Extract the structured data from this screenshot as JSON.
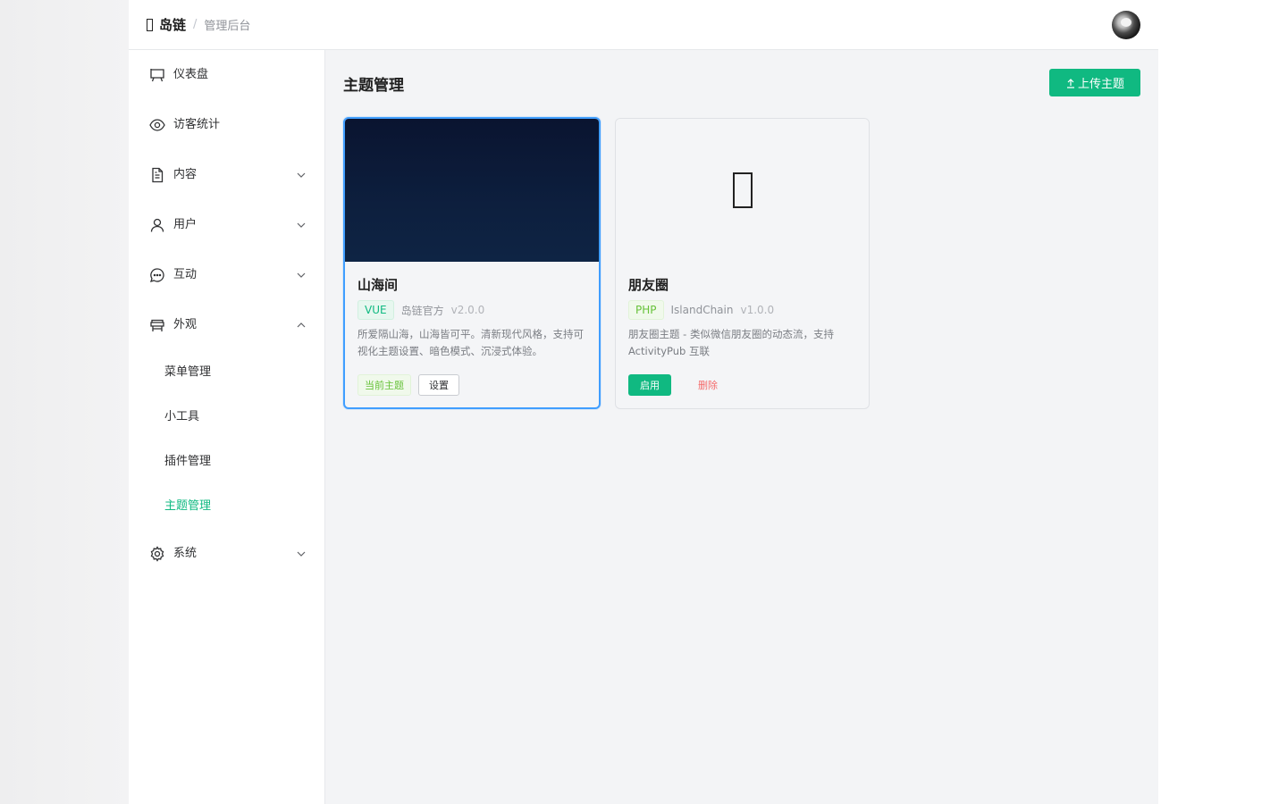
{
  "header": {
    "brand_name": "岛链",
    "brand_separator": "/",
    "brand_subtitle": "管理后台"
  },
  "sidebar": {
    "items": [
      {
        "label": "仪表盘",
        "icon": "dashboard-icon"
      },
      {
        "label": "访客统计",
        "icon": "eye-icon"
      },
      {
        "label": "内容",
        "icon": "document-icon",
        "expanded": false
      },
      {
        "label": "用户",
        "icon": "user-icon",
        "expanded": false
      },
      {
        "label": "互动",
        "icon": "chat-icon",
        "expanded": false
      },
      {
        "label": "外观",
        "icon": "appearance-icon",
        "expanded": true
      },
      {
        "label": "系统",
        "icon": "gear-icon",
        "expanded": false
      }
    ],
    "appearance_children": [
      {
        "label": "菜单管理",
        "active": false
      },
      {
        "label": "小工具",
        "active": false
      },
      {
        "label": "插件管理",
        "active": false
      },
      {
        "label": "主题管理",
        "active": true
      }
    ]
  },
  "main": {
    "title": "主题管理",
    "upload_label": "上传主题",
    "themes": [
      {
        "name": "山海间",
        "lang": "VUE",
        "author": "岛链官方",
        "version": "v2.0.0",
        "description": "所爱隔山海，山海皆可平。清新现代风格，支持可视化主题设置、暗色模式、沉浸式体验。",
        "current_label": "当前主题",
        "settings_label": "设置",
        "active": true
      },
      {
        "name": "朋友圈",
        "lang": "PHP",
        "author": "IslandChain",
        "version": "v1.0.0",
        "description": "朋友圈主题 - 类似微信朋友圈的动态流，支持 ActivityPub 互联",
        "enable_label": "启用",
        "delete_label": "删除",
        "active": false
      }
    ]
  },
  "colors": {
    "primary": "#10b981",
    "active_border": "#409eff",
    "danger": "#f56c6c"
  }
}
